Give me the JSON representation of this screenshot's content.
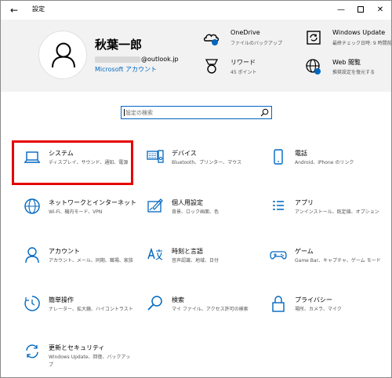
{
  "window": {
    "title": "設定",
    "back_glyph": "←",
    "minimize_glyph": "—",
    "close_glyph": "✕"
  },
  "account": {
    "name": "秋葉一郎",
    "email_suffix": "@outlook.jp",
    "account_link": "Microsoft アカウント"
  },
  "header_items": [
    {
      "title": "OneDrive",
      "subtitle": "ファイルのバックアップ",
      "icon": "onedrive-icon"
    },
    {
      "title": "Windows Update",
      "subtitle": "最終チェック日時: 9 時間前",
      "icon": "windows-update-icon"
    },
    {
      "title": "リワード",
      "subtitle": "45 ポイント",
      "icon": "rewards-icon"
    },
    {
      "title": "Web 閲覧",
      "subtitle": "推奨設定を復元する",
      "icon": "web-browsing-icon"
    }
  ],
  "search": {
    "placeholder": "設定の検索"
  },
  "tiles": [
    {
      "title": "システム",
      "subtitle": "ディスプレイ、サウンド、通知、電源",
      "icon": "laptop-icon"
    },
    {
      "title": "デバイス",
      "subtitle": "Bluetooth、プリンター、マウス",
      "icon": "devices-icon"
    },
    {
      "title": "電話",
      "subtitle": "Android、iPhone のリンク",
      "icon": "phone-icon"
    },
    {
      "title": "ネットワークとインターネット",
      "subtitle": "Wi-Fi、機内モード、VPN",
      "icon": "globe-icon"
    },
    {
      "title": "個人用設定",
      "subtitle": "背景、ロック画面、色",
      "icon": "personalization-icon"
    },
    {
      "title": "アプリ",
      "subtitle": "アンインストール、既定値、オプション",
      "icon": "apps-icon"
    },
    {
      "title": "アカウント",
      "subtitle": "アカウント、メール、同期、職場、家族",
      "icon": "account-icon"
    },
    {
      "title": "時刻と言語",
      "subtitle": "音声認識、地域、日付",
      "icon": "time-language-icon"
    },
    {
      "title": "ゲーム",
      "subtitle": "Game Bar、キャプチャ、ゲーム モード",
      "icon": "gamepad-icon"
    },
    {
      "title": "簡単操作",
      "subtitle": "ナレーター、拡大鏡、ハイコントラスト",
      "icon": "ease-of-access-icon"
    },
    {
      "title": "検索",
      "subtitle": "マイ ファイル、アクセス許可の検索",
      "icon": "search-icon"
    },
    {
      "title": "プライバシー",
      "subtitle": "場所、カメラ、マイク",
      "icon": "lock-icon"
    },
    {
      "title": "更新とセキュリティ",
      "subtitle": "Windows Update、回復、バックアップ",
      "icon": "update-security-icon"
    }
  ],
  "colors": {
    "accent": "#0067c0",
    "highlight": "#e60000",
    "header_bg": "#f2f2f2"
  }
}
